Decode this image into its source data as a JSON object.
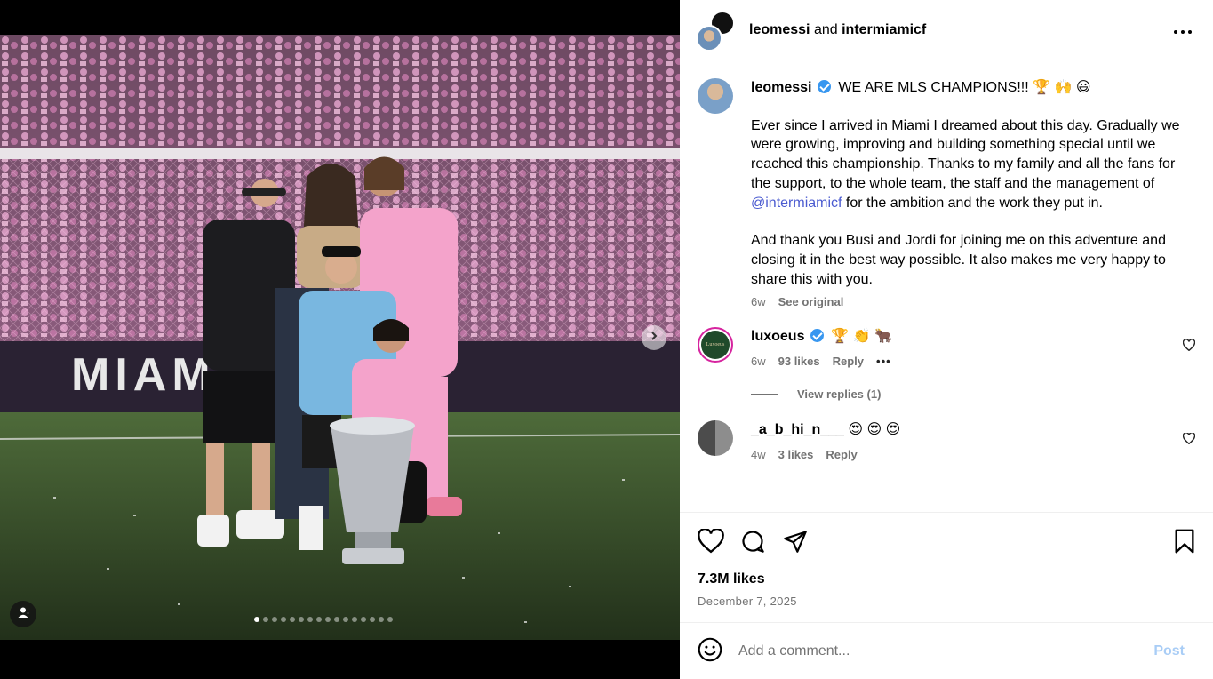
{
  "header": {
    "user1": "leomessi",
    "joiner": "and",
    "user2": "intermiamicf",
    "more_icon": "more-horizontal-icon"
  },
  "photo": {
    "banner_text": "MIAMI",
    "carousel_dot_count": 16,
    "active_dot_index": 0,
    "next_icon": "chevron-right-icon",
    "tag_icon": "user-tag-icon"
  },
  "caption": {
    "username": "leomessi",
    "headline": "WE ARE MLS CHAMPIONS!!! 🏆 🙌 😃",
    "paragraph1_a": "Ever since I arrived in Miami I dreamed about this day. Gradually we were growing, improving and building something special until we reached this championship. Thanks to my family and all the fans for the support, to the whole team, the staff and the management of ",
    "mention": "@intermiamicf",
    "paragraph1_b": " for the ambition and the work they put in.",
    "paragraph2": "And thank you Busi and Jordi for joining me on this adventure and closing it in the best way possible. It also makes me very happy to share this with you.",
    "time": "6w",
    "see_original": "See original"
  },
  "comments": [
    {
      "username": "luxoeus",
      "avatar_text": "Luxoeus",
      "text": "🏆 👏 🐂",
      "time": "6w",
      "likes": "93 likes",
      "reply": "Reply",
      "more": "•••",
      "view_replies": "View replies (1)"
    },
    {
      "username": "_a_b_hi_n___",
      "text": "😍 😍 😍",
      "time": "4w",
      "likes": "3 likes",
      "reply": "Reply"
    }
  ],
  "actions": {
    "like_icon": "heart-icon",
    "comment_icon": "comment-icon",
    "share_icon": "share-icon",
    "save_icon": "bookmark-icon",
    "likes": "7.3M likes",
    "date": "December 7, 2025"
  },
  "add_comment": {
    "placeholder": "Add a comment...",
    "post_label": "Post",
    "emoji_icon": "emoji-icon"
  }
}
